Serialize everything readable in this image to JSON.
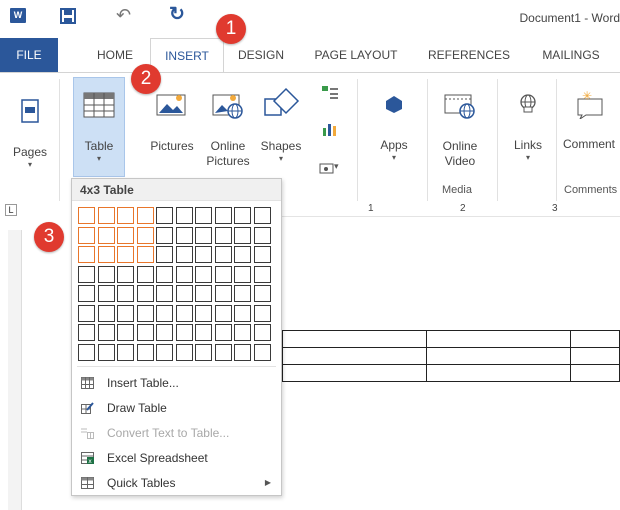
{
  "window": {
    "title": "Document1 - Word"
  },
  "tabs": [
    "FILE",
    "HOME",
    "INSERT",
    "DESIGN",
    "PAGE LAYOUT",
    "REFERENCES",
    "MAILINGS"
  ],
  "ribbon": {
    "pages": "Pages",
    "table": "Table",
    "pictures": "Pictures",
    "online_pictures": "Online Pictures",
    "shapes": "Shapes",
    "apps": "Apps",
    "online_video": "Online Video",
    "links": "Links",
    "comment": "Comment",
    "group_media": "Media",
    "group_comments": "Comments"
  },
  "table_menu": {
    "header": "4x3 Table",
    "grid_columns": 10,
    "grid_rows": 8,
    "selected_columns": 4,
    "selected_rows": 3,
    "items": [
      {
        "label": "Insert Table...",
        "icon": "table-icon",
        "enabled": true
      },
      {
        "label": "Draw Table",
        "icon": "draw-table-icon",
        "enabled": true
      },
      {
        "label": "Convert Text to Table...",
        "icon": "convert-icon",
        "enabled": false
      },
      {
        "label": "Excel Spreadsheet",
        "icon": "excel-icon",
        "enabled": true
      },
      {
        "label": "Quick Tables",
        "icon": "quick-tables-icon",
        "enabled": true,
        "submenu": true
      }
    ]
  },
  "ruler": {
    "numbers": [
      "1",
      "2",
      "3"
    ]
  },
  "callouts": [
    "1",
    "2",
    "3"
  ],
  "colors": {
    "accent": "#2b579a",
    "highlight": "#e8762b",
    "callout": "#e03a2f"
  }
}
